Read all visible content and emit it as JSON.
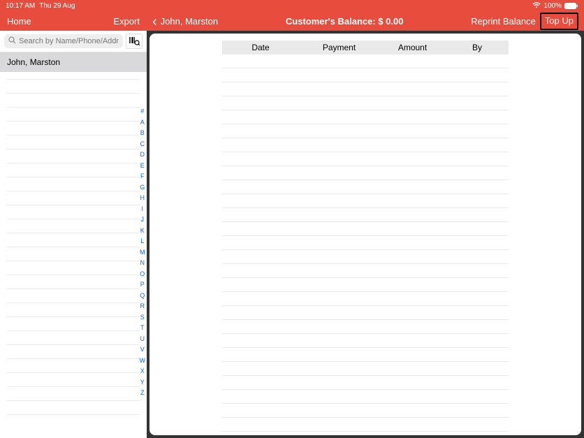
{
  "status": {
    "time": "10:17 AM",
    "date": "Thu 29 Aug",
    "battery_pct": "100%"
  },
  "sidebar": {
    "home_label": "Home",
    "export_label": "Export",
    "search_placeholder": "Search by Name/Phone/Addre...",
    "customer": "John, Marston",
    "alpha": [
      "#",
      "A",
      "B",
      "C",
      "D",
      "E",
      "F",
      "G",
      "H",
      "I",
      "J",
      "K",
      "L",
      "M",
      "N",
      "O",
      "P",
      "Q",
      "R",
      "S",
      "T",
      "U",
      "V",
      "W",
      "X",
      "Y",
      "Z"
    ]
  },
  "detail": {
    "customer_name": "John, Marston",
    "balance_label": "Customer's Balance: $ 0.00",
    "reprint_label": "Reprint Balance",
    "topup_label": "Top Up"
  },
  "table": {
    "headers": {
      "date": "Date",
      "payment": "Payment",
      "amount": "Amount",
      "by": "By"
    }
  }
}
